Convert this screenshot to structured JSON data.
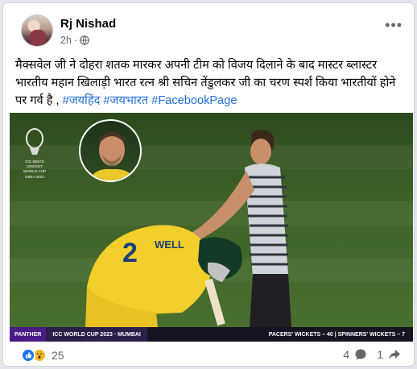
{
  "post": {
    "author": "Rj Nishad",
    "time": "2h",
    "more_icon": "more-icon",
    "privacy_icon": "globe-icon",
    "text_main": "मैक्सवेल जी ने दोहरा शतक मारकर अपनी टीम को विजय दिलाने के बाद मास्टर ब्लास्टर भारतीय महान खिलाड़ी भारत रत्न श्री सचिन तेंडुलकर जी का चरण स्पर्श किया भारतीयों होने पर गर्व है , ",
    "hashtags": [
      "#जयहिंद",
      "#जयभारत",
      "#FacebookPage"
    ]
  },
  "media": {
    "logo_lines": [
      "ICC MEN'S",
      "CRICKET",
      "WORLD CUP",
      "INDIA 2023"
    ],
    "jersey_text": "2",
    "jersey_name": "WELL",
    "broadcast_brand": "PANTHER",
    "broadcast_event": "ICC WORLD CUP 2023 · MUMBAI",
    "broadcast_stats": "PACERS' WICKETS – 40 | SPINNERS' WICKETS – 7"
  },
  "engagement": {
    "reaction_count": "25",
    "comment_count": "4",
    "share_count": "1",
    "reaction_icons": [
      "like-icon",
      "wow-icon"
    ],
    "stat_icons": [
      "comment-icon",
      "share-icon"
    ]
  },
  "colors": {
    "hashtag": "#216fdb",
    "like": "#1b74e4",
    "wow": "#f7b928",
    "broadcast_bar": "#4a1b86"
  }
}
